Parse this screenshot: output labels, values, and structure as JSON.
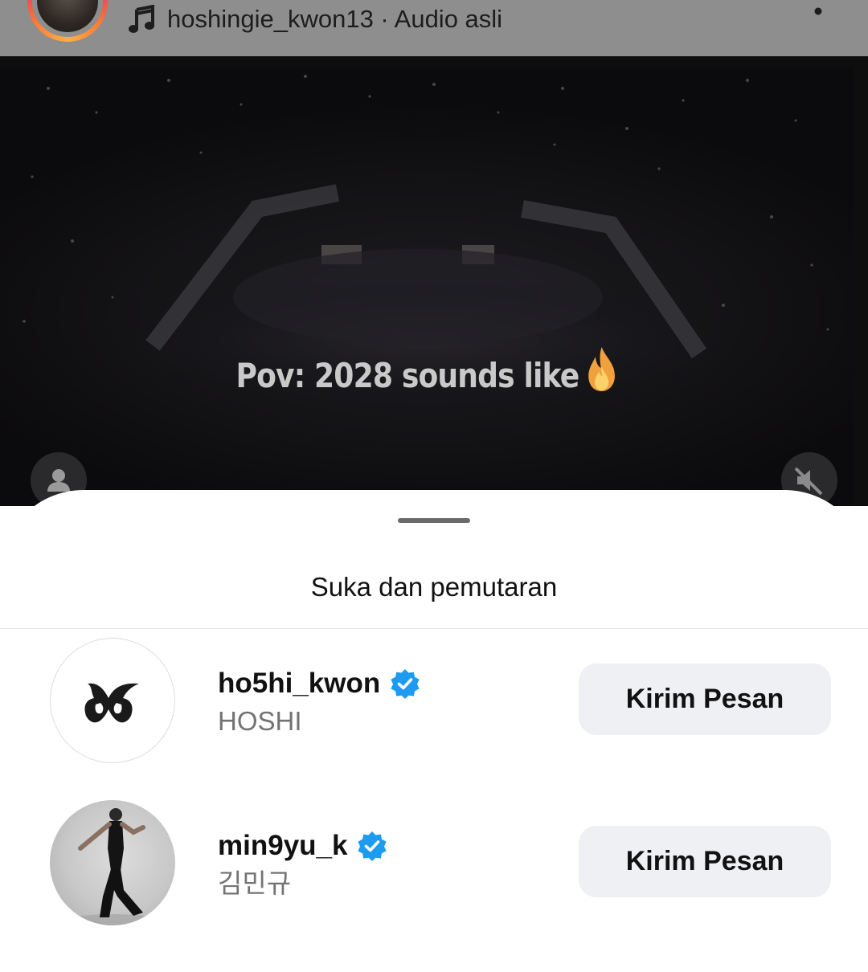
{
  "header": {
    "audio_text": "hoshingie_kwon13 · Audio asli",
    "icons": [
      "music-note-icon",
      "more-vertical-icon"
    ]
  },
  "video": {
    "caption": "Pov: 2028 sounds like",
    "caption_emoji": "fire-icon",
    "buttons": [
      "profile-icon",
      "muted-speaker-icon"
    ]
  },
  "sheet": {
    "title": "Suka dan pemutaran",
    "users": [
      {
        "username": "ho5hi_kwon",
        "full_name": "HOSHI",
        "verified": true,
        "button_label": "Kirim Pesan",
        "avatar": "logo"
      },
      {
        "username": "min9yu_k",
        "full_name": "김민규",
        "verified": true,
        "button_label": "Kirim Pesan",
        "avatar": "photo"
      }
    ]
  },
  "colors": {
    "verified_badge": "#1d9bf0",
    "button_bg": "#eff0f4",
    "secondary_text": "#737373"
  }
}
